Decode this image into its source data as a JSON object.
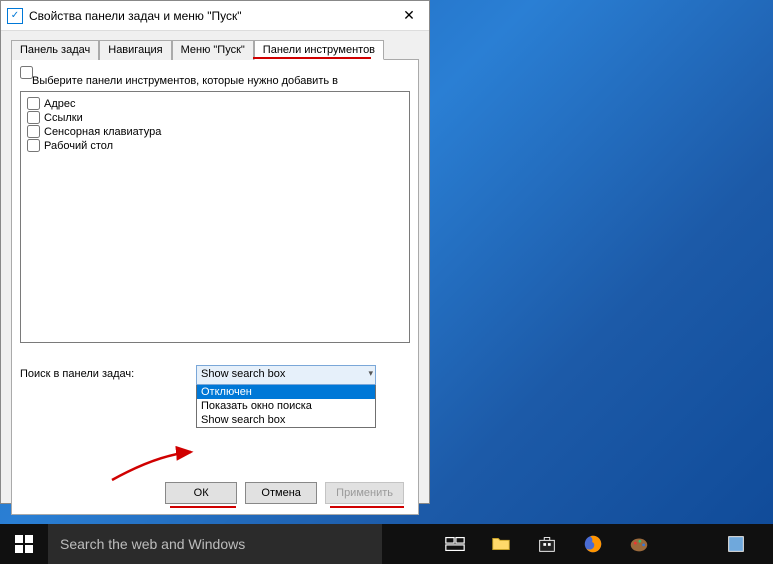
{
  "window": {
    "title": "Свойства панели задач и меню \"Пуск\""
  },
  "tabs": [
    {
      "label": "Панель задач"
    },
    {
      "label": "Навигация"
    },
    {
      "label": "Меню \"Пуск\""
    },
    {
      "label": "Панели инструментов"
    }
  ],
  "active_tab_index": 3,
  "instruction": "Выберите панели инструментов, которые нужно добавить в",
  "toolbars": [
    {
      "label": "Адрес",
      "checked": false
    },
    {
      "label": "Ссылки",
      "checked": false
    },
    {
      "label": "Сенсорная клавиатура",
      "checked": false
    },
    {
      "label": "Рабочий стол",
      "checked": false
    }
  ],
  "search_section": {
    "label": "Поиск в панели задач:",
    "selected": "Show search box",
    "options": [
      {
        "label": "Отключен",
        "highlighted": true
      },
      {
        "label": "Показать окно поиска",
        "highlighted": false
      },
      {
        "label": "Show search box",
        "highlighted": false
      }
    ]
  },
  "buttons": {
    "ok": "ОК",
    "cancel": "Отмена",
    "apply": "Применить"
  },
  "taskbar": {
    "search_placeholder": "Search the web and Windows"
  },
  "annotations": {
    "underline_color": "#d00000",
    "arrow_color": "#d00000"
  }
}
